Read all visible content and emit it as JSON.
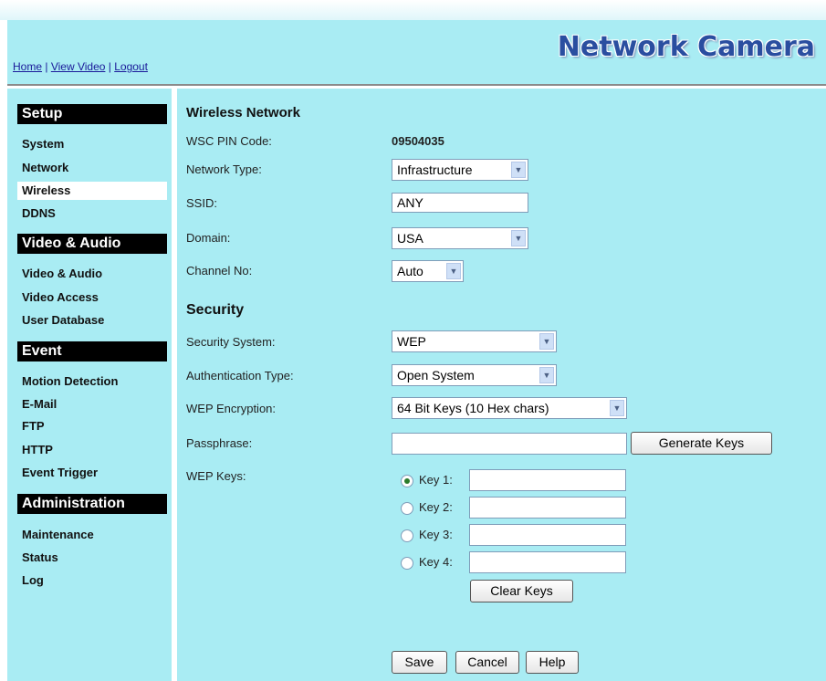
{
  "header": {
    "links": [
      "Home",
      "View Video",
      "Logout"
    ],
    "brand": "Network Camera"
  },
  "sidebar": {
    "sections": [
      {
        "title": "Setup",
        "items": [
          "System",
          "Network",
          "Wireless",
          "DDNS"
        ]
      },
      {
        "title": "Video & Audio",
        "items": [
          "Video & Audio",
          "Video Access",
          "User Database"
        ]
      },
      {
        "title": "Event",
        "items": [
          "Motion Detection",
          "E-Mail",
          "FTP",
          "HTTP",
          "Event Trigger"
        ]
      },
      {
        "title": "Administration",
        "items": [
          "Maintenance",
          "Status",
          "Log"
        ]
      }
    ],
    "active_item": "Wireless"
  },
  "wireless": {
    "heading": "Wireless Network",
    "wsc_pin_label": "WSC PIN Code:",
    "wsc_pin_value": "09504035",
    "network_type_label": "Network Type:",
    "network_type_value": "Infrastructure",
    "ssid_label": "SSID:",
    "ssid_value": "ANY",
    "domain_label": "Domain:",
    "domain_value": "USA",
    "channel_label": "Channel No:",
    "channel_value": "Auto"
  },
  "security": {
    "heading": "Security",
    "system_label": "Security System:",
    "system_value": "WEP",
    "auth_label": "Authentication Type:",
    "auth_value": "Open System",
    "encryption_label": "WEP Encryption:",
    "encryption_value": "64 Bit Keys (10 Hex chars)",
    "passphrase_label": "Passphrase:",
    "passphrase_value": "",
    "generate_button": "Generate Keys",
    "wep_keys_label": "WEP Keys:",
    "keys": [
      {
        "label": "Key 1:",
        "selected": true,
        "value": ""
      },
      {
        "label": "Key 2:",
        "selected": false,
        "value": ""
      },
      {
        "label": "Key 3:",
        "selected": false,
        "value": ""
      },
      {
        "label": "Key 4:",
        "selected": false,
        "value": ""
      }
    ],
    "clear_button": "Clear Keys"
  },
  "actions": {
    "save": "Save",
    "cancel": "Cancel",
    "help": "Help"
  },
  "colors": {
    "panel_bg": "#a9ecf3",
    "brand_color": "#2a4ea0",
    "section_header_bg": "#000000"
  }
}
